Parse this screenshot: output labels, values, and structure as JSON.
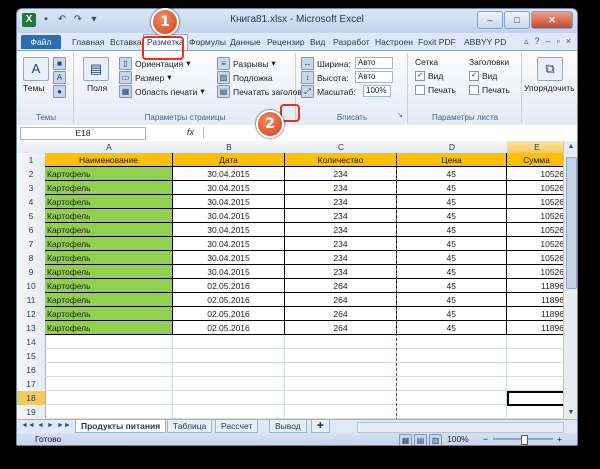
{
  "window": {
    "title": "Книга81.xlsx - Microsoft Excel",
    "app_icon": "X",
    "qat_icons": [
      "save-icon",
      "undo-icon",
      "redo-icon"
    ],
    "window_buttons": [
      "–",
      "□",
      "✕"
    ]
  },
  "tabs": {
    "file": "Файл",
    "items": [
      "Главная",
      "Вставка",
      "Разметка",
      "Формулы",
      "Данные",
      "Рецензир",
      "Вид",
      "Разработ",
      "Настроен",
      "Foxit PDF",
      "ABBYY PD"
    ],
    "active": "Разметка"
  },
  "ribbon": {
    "themes": {
      "label": "Темы",
      "group": "Темы"
    },
    "page_setup": {
      "group": "Параметры страницы",
      "margins": "Поля",
      "orientation": "Ориентация",
      "size": "Размер",
      "print_area": "Область печати",
      "breaks": "Разрывы",
      "background": "Подложка",
      "print_titles": "Печатать заголовки"
    },
    "scale": {
      "group": "Вписать",
      "width_label": "Ширина:",
      "width_value": "Авто",
      "height_label": "Высота:",
      "height_value": "Авто",
      "scale_label": "Масштаб:",
      "scale_value": "100%"
    },
    "sheet_options": {
      "group": "Параметры листа",
      "grid_title": "Сетка",
      "headings_title": "Заголовки",
      "view": "Вид",
      "print": "Печать",
      "grid_view_checked": true,
      "headings_view_checked": true
    },
    "arrange": {
      "label": "Упорядочить"
    }
  },
  "formula_bar": {
    "name_box": "E18",
    "fx": "fx",
    "value": ""
  },
  "sheet": {
    "columns": [
      "A",
      "B",
      "C",
      "D",
      "E"
    ],
    "selected_column": "E",
    "rows": [
      "1",
      "2",
      "3",
      "4",
      "5",
      "6",
      "7",
      "8",
      "9",
      "10",
      "11",
      "12",
      "13",
      "14",
      "15",
      "16",
      "17",
      "18",
      "19"
    ],
    "selected_row": "18",
    "headers": [
      "Наименование",
      "Дата",
      "Количество",
      "Цена",
      "Сумма"
    ],
    "data": [
      [
        "Картофель",
        "30.04.2015",
        "234",
        "45",
        "10526"
      ],
      [
        "Картофель",
        "30.04.2015",
        "234",
        "45",
        "10526"
      ],
      [
        "Картофель",
        "30.04.2015",
        "234",
        "45",
        "10526"
      ],
      [
        "Картофель",
        "30.04.2015",
        "234",
        "45",
        "10526"
      ],
      [
        "Картофель",
        "30.04.2015",
        "234",
        "45",
        "10526"
      ],
      [
        "Картофель",
        "30.04.2015",
        "234",
        "45",
        "10526"
      ],
      [
        "Картофель",
        "30.04.2015",
        "234",
        "45",
        "10526"
      ],
      [
        "Картофель",
        "30.04.2015",
        "234",
        "45",
        "10526"
      ],
      [
        "Картофель",
        "02.05.2016",
        "264",
        "45",
        "11896"
      ],
      [
        "Картофель",
        "02.05.2016",
        "264",
        "45",
        "11896"
      ],
      [
        "Картофель",
        "02.05.2016",
        "264",
        "45",
        "11896"
      ],
      [
        "Картофель",
        "02.05.2016",
        "264",
        "45",
        "11896"
      ]
    ],
    "tabs": [
      "Продукты питания",
      "Таблица",
      "Рассчет",
      "Вывод"
    ],
    "active_tab": "Продукты питания"
  },
  "status": {
    "ready": "Готово",
    "zoom": "100%",
    "minus": "−",
    "plus": "+"
  },
  "callouts": [
    "1",
    "2"
  ],
  "colors": {
    "name_fill": "#92d050",
    "header_fill": "#ffc000",
    "callout": "#d3401a"
  }
}
